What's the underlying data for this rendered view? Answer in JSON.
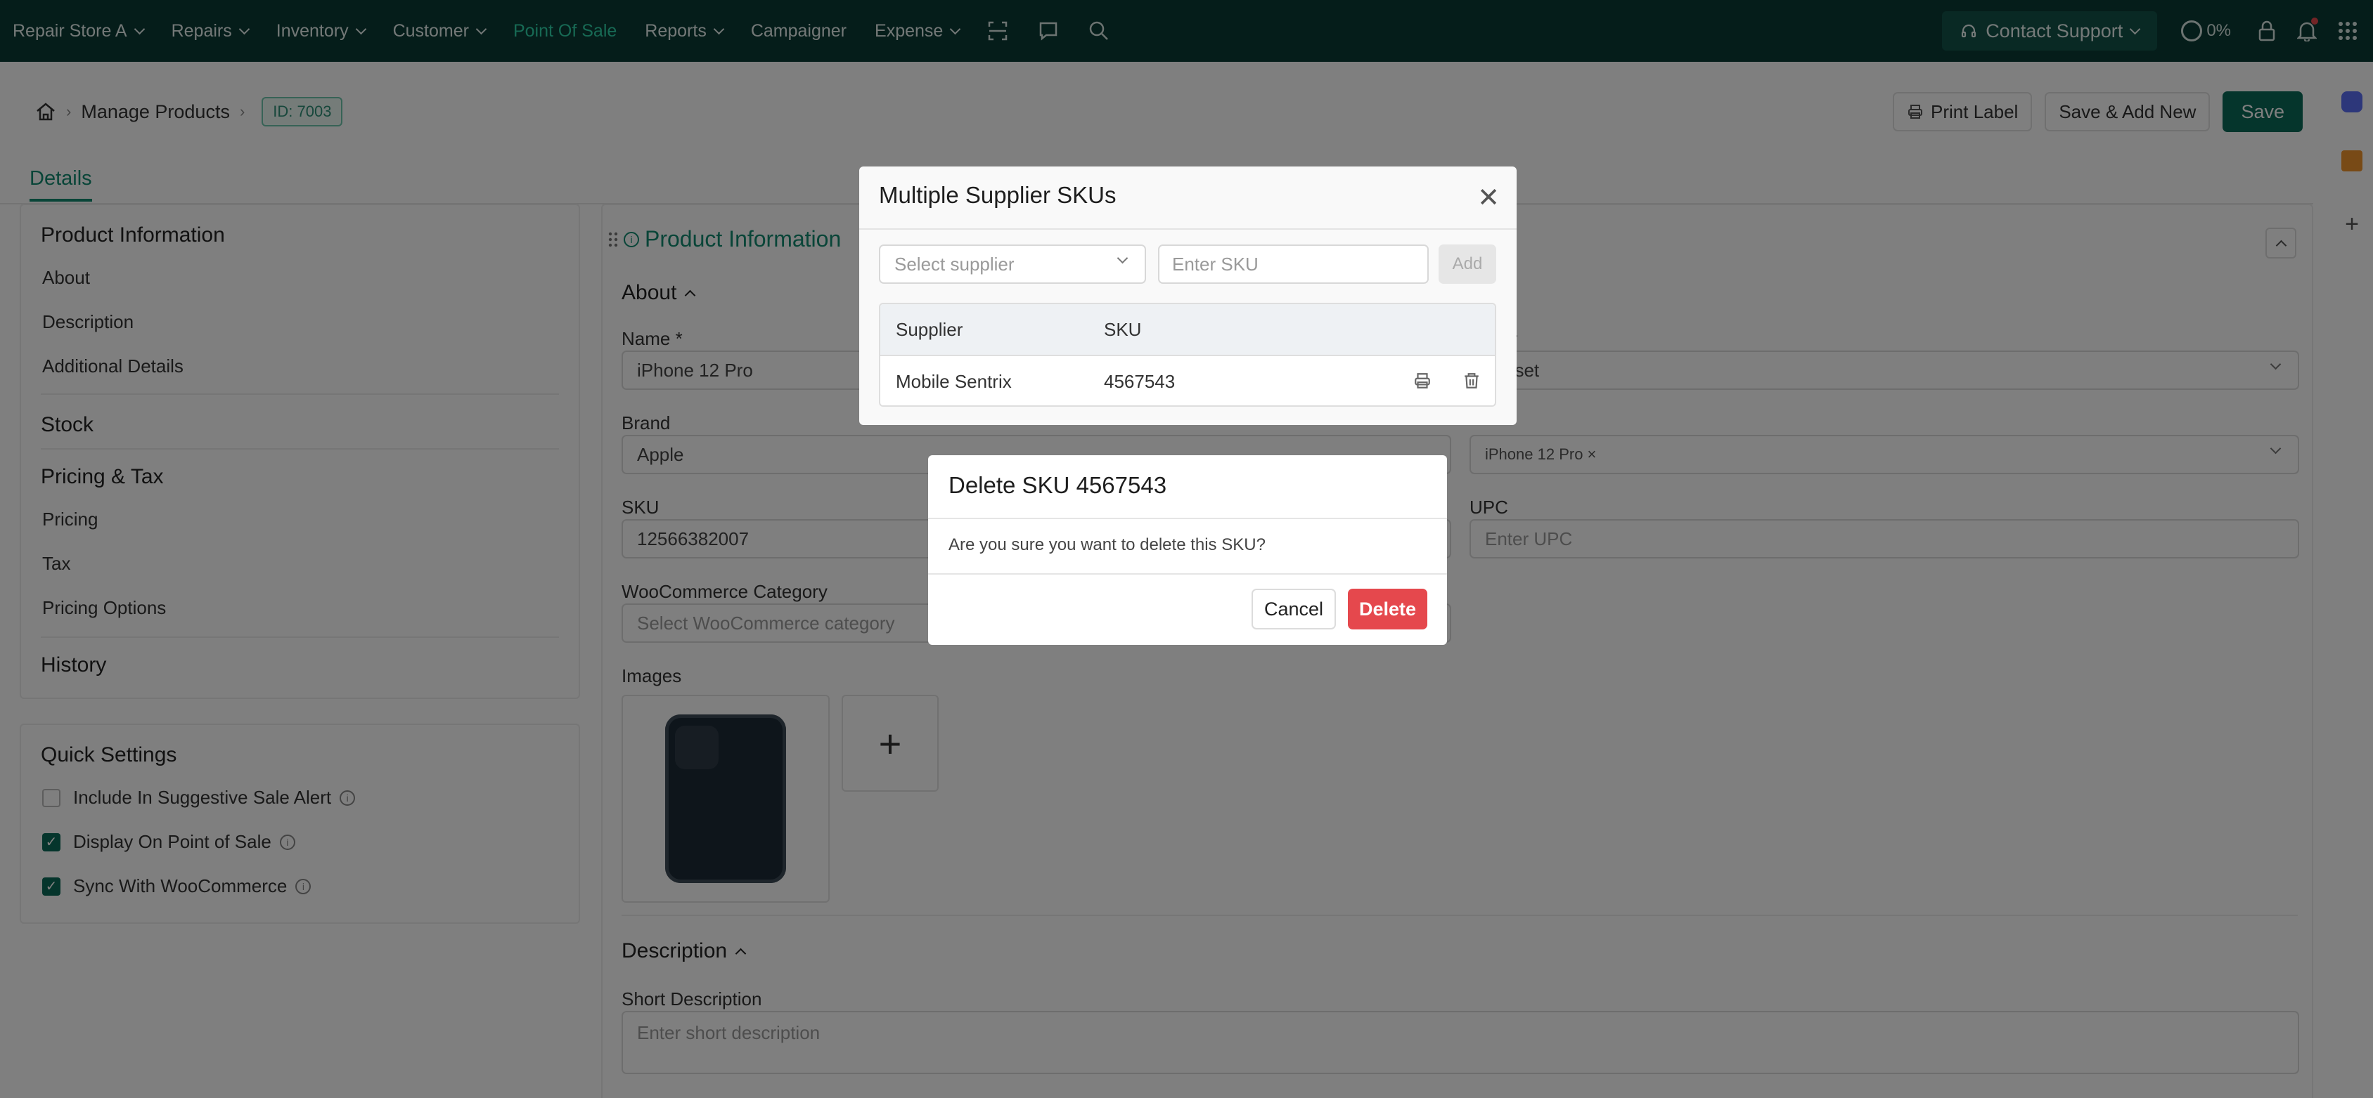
{
  "nav": {
    "store": "Repair Store A",
    "items": [
      "Repairs",
      "Inventory",
      "Customer",
      "Point Of Sale",
      "Reports",
      "Campaigner",
      "Expense"
    ],
    "support": "Contact Support",
    "progress": "0%"
  },
  "breadcrumb": {
    "page": "Manage Products",
    "id_badge": "ID: 7003"
  },
  "actions": {
    "print": "Print Label",
    "save_add": "Save & Add New",
    "save": "Save"
  },
  "tabs": {
    "details": "Details"
  },
  "sidebar": {
    "product_info": "Product Information",
    "about": "About",
    "description": "Description",
    "additional": "Additional Details",
    "stock": "Stock",
    "pricing_tax": "Pricing & Tax",
    "pricing": "Pricing",
    "tax": "Tax",
    "pricing_options": "Pricing Options",
    "history": "History"
  },
  "quick_settings": {
    "title": "Quick Settings",
    "suggestive": "Include In Suggestive Sale Alert",
    "display_pos": "Display On Point of Sale",
    "sync_woo": "Sync With WooCommerce"
  },
  "form": {
    "section_title": "Product Information",
    "about": "About",
    "name_label": "Name *",
    "name_value": "iPhone 12 Pro",
    "brand_label": "Brand",
    "brand_value": "Apple",
    "sku_label": "SKU",
    "sku_value": "12566382007",
    "woo_label": "WooCommerce Category",
    "woo_placeholder": "Select WooCommerce category",
    "images_label": "Images",
    "category_label": "ory",
    "category_value": "dset",
    "model_value": "iPhone 12 Pro ×",
    "upc_label": "UPC",
    "upc_placeholder": "Enter UPC",
    "description_title": "Description",
    "short_desc_label": "Short Description",
    "short_desc_placeholder": "Enter short description"
  },
  "sku_modal": {
    "title": "Multiple Supplier SKUs",
    "supplier_placeholder": "Select supplier",
    "sku_placeholder": "Enter SKU",
    "add": "Add",
    "col_supplier": "Supplier",
    "col_sku": "SKU",
    "rows": [
      {
        "supplier": "Mobile Sentrix",
        "sku": "4567543"
      }
    ]
  },
  "delete_modal": {
    "title": "Delete SKU 4567543",
    "message": "Are you sure you want to delete this SKU?",
    "cancel": "Cancel",
    "delete": "Delete"
  },
  "colors": {
    "nav_bg": "#0a3b35",
    "accent": "#0a6b58",
    "danger": "#e5484d",
    "active_nav": "#2fd3a8"
  }
}
